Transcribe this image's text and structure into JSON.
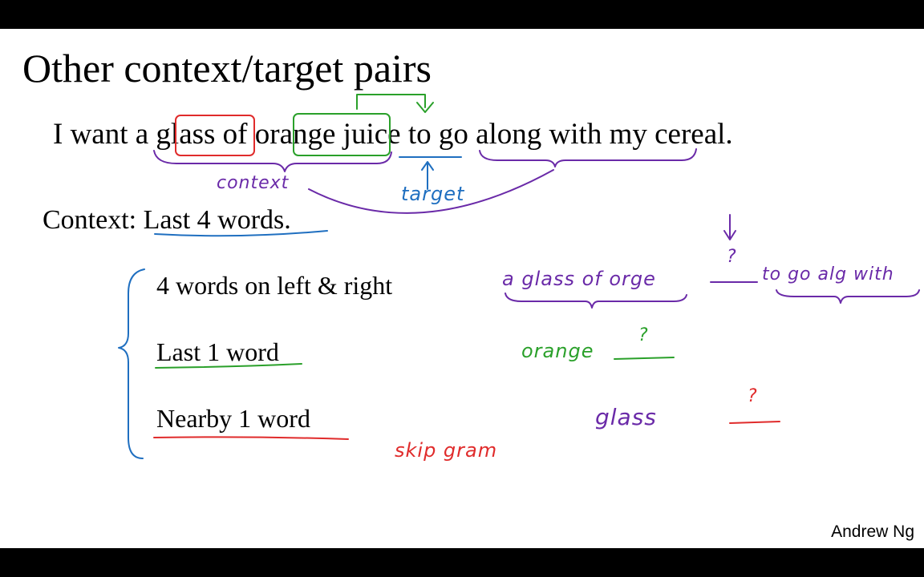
{
  "title": "Other context/target pairs",
  "sentence": {
    "pre": "I want a",
    "glass": "glass",
    "of": "of",
    "orange": "orange",
    "juice": "juice",
    "post1": "to go along with",
    "post2": "my cereal."
  },
  "context_label": {
    "prefix": "Context:",
    "value": "Last 4 words."
  },
  "options": [
    "4 words on left & right",
    "Last 1 word",
    "Nearby 1 word"
  ],
  "annotations": {
    "context": "context",
    "target": "target",
    "left_context": "a glass of orge",
    "question_1": "?",
    "right_context": "to go alg with",
    "orange": "orange",
    "question_2": "?",
    "glass": "glass",
    "question_3": "?",
    "skip_gram": "skip gram"
  },
  "footer": "Andrew Ng",
  "colors": {
    "red": "#e02b2b",
    "green": "#2aa02a",
    "blue": "#1f6fc0",
    "purple": "#6a2aa8",
    "black": "#000000"
  }
}
